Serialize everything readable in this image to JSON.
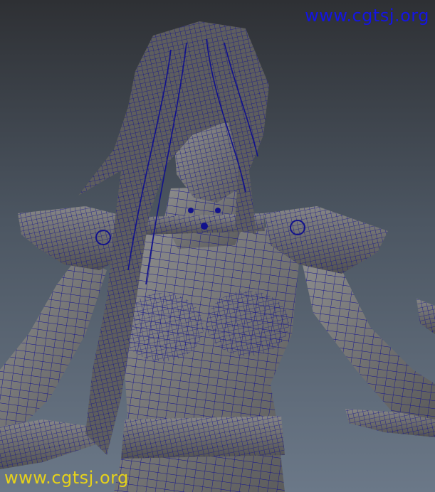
{
  "viewport": {
    "name": "3d-viewport",
    "render_mode": "wireframe-on-shaded",
    "colors": {
      "wire": "#12128c",
      "mesh": "#6e6e6e",
      "mesh_light": "#8a8a8a",
      "mesh_dark": "#4f4f4f",
      "background_top": "#2e3034",
      "background_bottom": "#6b7888"
    }
  },
  "watermarks": {
    "top": {
      "text": "www.cgtsj.org",
      "color": "#1414e6"
    },
    "bottom": {
      "text": "www.cgtsj.org",
      "color": "#e6d21a"
    }
  }
}
